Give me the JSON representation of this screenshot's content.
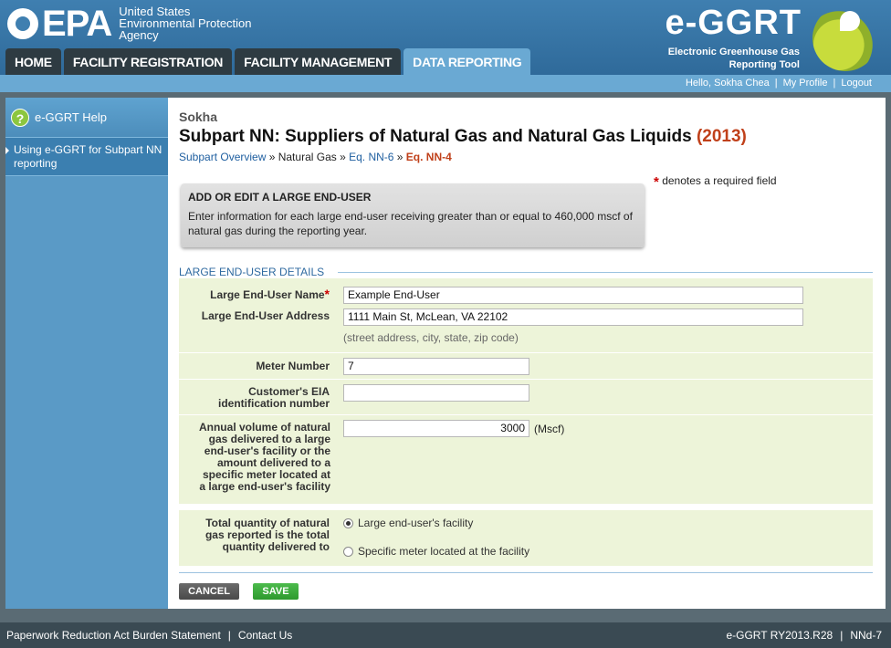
{
  "header": {
    "epa_logo_text": "EPA",
    "agency_line1": "United States",
    "agency_line2": "Environmental Protection",
    "agency_line3": "Agency",
    "app_title": "e-GGRT",
    "app_subtitle_line1": "Electronic Greenhouse Gas",
    "app_subtitle_line2": "Reporting Tool"
  },
  "tabs": [
    {
      "label": "HOME"
    },
    {
      "label": "FACILITY REGISTRATION"
    },
    {
      "label": "FACILITY MANAGEMENT"
    },
    {
      "label": "DATA REPORTING"
    }
  ],
  "userbar": {
    "greeting": "Hello, Sokha Chea",
    "my_profile": "My Profile",
    "logout": "Logout",
    "separator": "|"
  },
  "sidebar": {
    "help_label": "e-GGRT Help",
    "help_icon_glyph": "?",
    "link_label": "Using e-GGRT for Subpart NN reporting"
  },
  "main": {
    "facility_name": "Sokha",
    "title": "Subpart NN: Suppliers of Natural Gas and Natural Gas Liquids",
    "title_year": "(2013)",
    "breadcrumb": {
      "overview": "Subpart Overview",
      "sep": " » ",
      "natural_gas": "Natural Gas",
      "eq6": "Eq. NN-6",
      "eq4": "Eq. NN-4"
    },
    "required_note_star": "*",
    "required_note": "denotes a required field",
    "infobox_title": "ADD OR EDIT A LARGE END-USER",
    "infobox_text": "Enter information for each large end-user receiving greater than or equal to 460,000 mscf of natural gas during the reporting year.",
    "section_heading": "LARGE END-USER DETAILS"
  },
  "form": {
    "name_label": "Large End-User Name",
    "name_required": "*",
    "name_value": "Example End-User",
    "address_label": "Large End-User Address",
    "address_value": "1111 Main St, McLean, VA 22102",
    "address_hint": "(street address, city, state, zip code)",
    "meter_label": "Meter Number",
    "meter_value": "7",
    "eia_label_line1": "Customer's EIA",
    "eia_label_line2": "identification number",
    "eia_value": "",
    "volume_label_lines": [
      "Annual volume of natural",
      "gas delivered to a large",
      "end-user's facility or the",
      "amount delivered to a",
      "specific meter located at",
      "a large end-user's facility"
    ],
    "volume_value": "3000",
    "volume_unit": "(Mscf)",
    "total_label_lines": [
      "Total quantity of natural",
      "gas reported is the total",
      "quantity delivered to"
    ],
    "option_facility": "Large end-user's facility",
    "option_meter": "Specific meter located at the facility",
    "selected_option": "facility"
  },
  "buttons": {
    "cancel": "CANCEL",
    "save": "SAVE"
  },
  "footer": {
    "paperwork": "Paperwork Reduction Act Burden Statement",
    "contact": "Contact Us",
    "version": "e-GGRT RY2013.R28",
    "screen_id": "NNd-7",
    "sep": "|"
  },
  "colors": {
    "header_blue": "#3f7fb0",
    "tab_active": "#6aa9d3",
    "form_row_bg": "#edf4d9",
    "link_blue": "#1f5fa0",
    "accent_red": "#c0401a",
    "save_green": "#2e9a2e"
  }
}
